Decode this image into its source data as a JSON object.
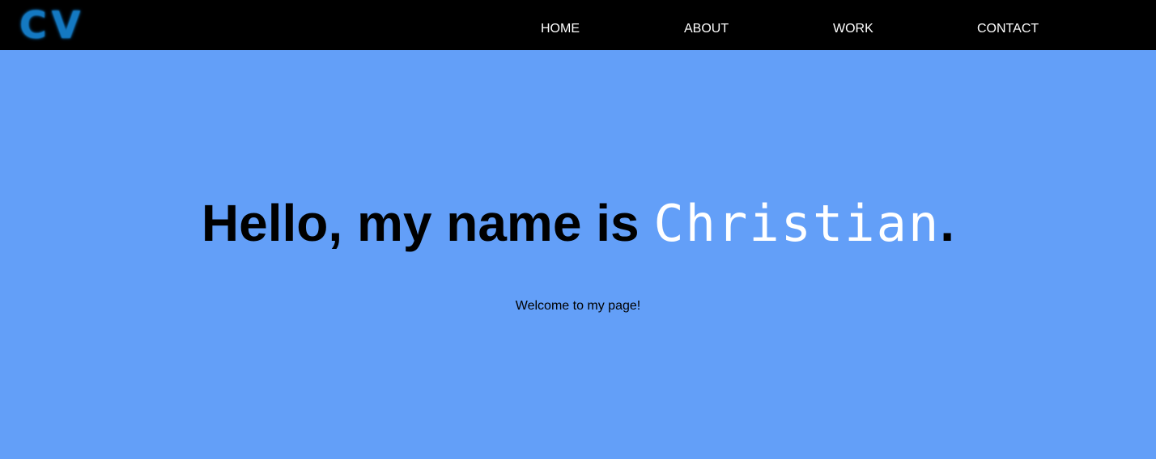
{
  "header": {
    "logo_text": "CV",
    "nav": {
      "home": "HOME",
      "about": "ABOUT",
      "work": "WORK",
      "contact": "CONTACT"
    }
  },
  "hero": {
    "greeting": "Hello, my name is ",
    "name": "Christian",
    "punctuation": ".",
    "subtitle": "Welcome to my page!"
  },
  "colors": {
    "background": "#639ff8",
    "navbar": "#000000",
    "logo": "#1479c2",
    "name_highlight": "#ffffff"
  }
}
